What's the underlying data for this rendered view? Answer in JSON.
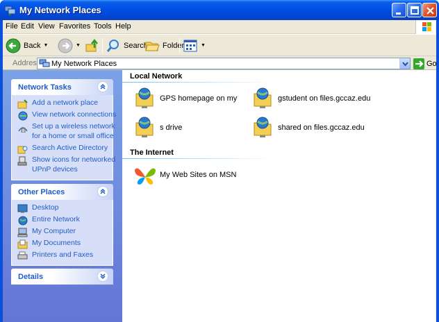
{
  "window": {
    "title": "My Network Places"
  },
  "menubar": {
    "items": [
      "File",
      "Edit",
      "View",
      "Favorites",
      "Tools",
      "Help"
    ]
  },
  "toolbar": {
    "back": "Back",
    "search": "Search",
    "folders": "Folders"
  },
  "address": {
    "label": "Address",
    "value": "My Network Places",
    "go": "Go"
  },
  "taskpane": {
    "network_tasks": {
      "title": "Network Tasks",
      "items": [
        "Add a network place",
        "View network connections",
        "Set up a wireless network",
        "for a home or small office",
        "Search Active Directory",
        "Show icons for networked",
        "UPnP devices"
      ]
    },
    "other_places": {
      "title": "Other Places",
      "items": [
        "Desktop",
        "Entire Network",
        "My Computer",
        "My Documents",
        "Printers and Faxes"
      ]
    },
    "details": {
      "title": "Details"
    }
  },
  "content": {
    "local_network": {
      "title": "Local Network",
      "items": [
        "GPS homepage on my",
        "gstudent on files.gccaz.edu",
        "s drive",
        "shared on files.gccaz.edu"
      ]
    },
    "internet": {
      "title": "The Internet",
      "items": [
        "My Web Sites on MSN"
      ]
    }
  },
  "colors": {
    "titlebar": "#0050e6",
    "taskpane": "#7ba2e7",
    "link": "#215dc6"
  },
  "icons": [
    "network-places-icon",
    "back-arrow-icon",
    "forward-arrow-icon",
    "up-folder-icon",
    "search-icon",
    "folders-icon",
    "views-icon",
    "go-arrow-icon",
    "network-folder-icon",
    "msn-butterfly-icon"
  ]
}
